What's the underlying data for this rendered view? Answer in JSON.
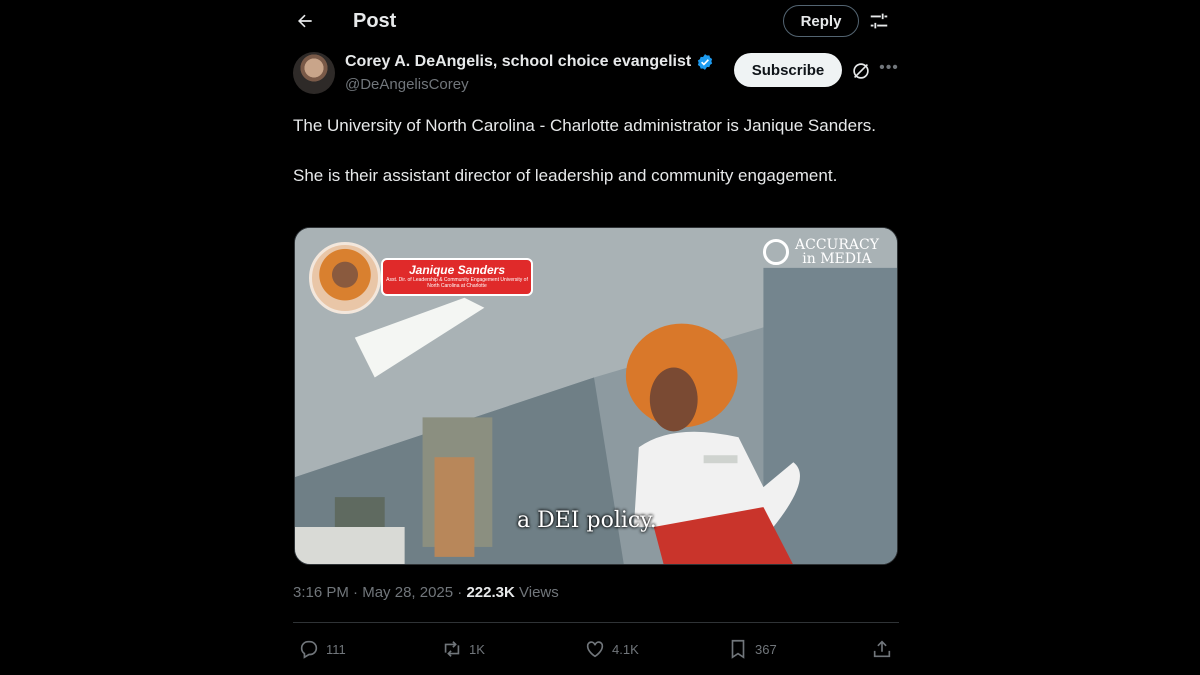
{
  "header": {
    "title": "Post",
    "reply_label": "Reply"
  },
  "author": {
    "name": "Corey A. DeAngelis, school choice evangelist",
    "handle": "@DeAngelisCorey",
    "subscribe_label": "Subscribe",
    "verified_color": "#1d9bf0"
  },
  "tweet": {
    "paragraphs": [
      "The University of North Carolina - Charlotte administrator is Janique Sanders.",
      "She is their assistant director of leadership and community engagement."
    ]
  },
  "media": {
    "subtitle": "a DEI policy.",
    "nameplate_name": "Janique Sanders",
    "nameplate_sub": "Asst. Dir. of Leadership & Community Engagement University of North Carolina at Charlotte",
    "watermark_line1": "ACCURACY",
    "watermark_line2": "in MEDIA"
  },
  "meta": {
    "time": "3:16 PM",
    "date": "May 28, 2025",
    "views_count": "222.3K",
    "views_label": "Views"
  },
  "actions": {
    "replies": "111",
    "reposts": "1K",
    "likes": "4.1K",
    "bookmarks": "367"
  },
  "icons": [
    "back-arrow-icon",
    "tune-icon",
    "verified-icon",
    "grok-icon",
    "more-icon",
    "reply-icon",
    "repost-icon",
    "like-icon",
    "bookmark-icon",
    "share-icon"
  ]
}
